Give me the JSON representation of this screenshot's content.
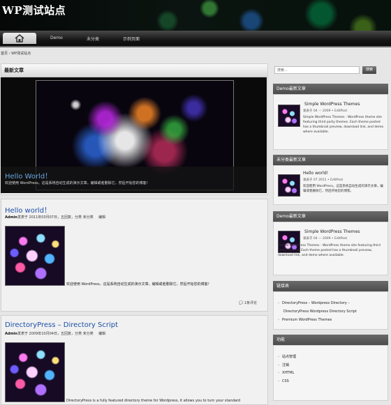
{
  "site": {
    "title": "WP测试站点"
  },
  "nav": {
    "home_icon": "home-icon",
    "items": [
      "Demo",
      "未分类",
      "示例页面"
    ]
  },
  "breadcrumb": "首页 › WP测试站点",
  "featured": {
    "heading": "最新文章",
    "slide_title": "Hello World！",
    "slide_excerpt": "欢迎使用 WordPress。这是系统自动生成的演示文章。编辑或者删除它，然后开始您的博客！"
  },
  "posts": [
    {
      "title": "Hello world！",
      "author": "Admin",
      "meta": "发表于 2011年03月07日，五回复，分类 未分类",
      "edit": "编辑",
      "excerpt": "欢迎使用 WordPress。这是系统自动生成的演示文章。编辑或者删除它，然后开始您的博客！",
      "comments": "1条评论"
    },
    {
      "title": "DirectoryPress – Directory Script",
      "author": "Admin",
      "meta": "发表于 2009年10月04日，五回复，分类 未分类",
      "edit": "编辑",
      "excerpt": "DirectoryPress is a fully featured directory theme for Wordpress, it allows you to turn your standard"
    }
  ],
  "search": {
    "placeholder": "搜索...",
    "button": "搜索"
  },
  "sidebar": {
    "demo_latest": {
      "heading": "Demo最新文章",
      "title": "Simple WordPress Themes",
      "meta": "发表于 04 — 2009 • EditPost",
      "text": "Simple WordPress Themes - WordPress theme site featuring third party themes. Each theme posted has a thumbnail preview, download link, and demo where available."
    },
    "uncat_latest": {
      "heading": "未分类最新文章",
      "title": "Hello world!",
      "meta": "发表于 07 2011 • EditPost",
      "text": "欢迎使用 WordPress。这是系统自动生成的演示文章。编辑或者删除它，然后开始您的博客。"
    },
    "demo_latest2": {
      "heading": "Demo最新文章",
      "title": "Simple WordPress Themes",
      "meta": "发表于 04 — 2009 • EditPost",
      "text": "Simple WordPress Themes - WordPress theme site featuring third party themes. Each theme posted has a thumbnail preview, download link, and demo where available."
    },
    "links": {
      "heading": "链接表",
      "items": [
        "DirectoryPress – Wordpress Directory –",
        "Premium WordPress Themes"
      ],
      "sub": "DirectoryPress Wordpress Directory Script"
    },
    "meta_widget": {
      "heading": "功能",
      "items": [
        "站点管理",
        "注销",
        "XHTML",
        "CSS"
      ]
    }
  }
}
